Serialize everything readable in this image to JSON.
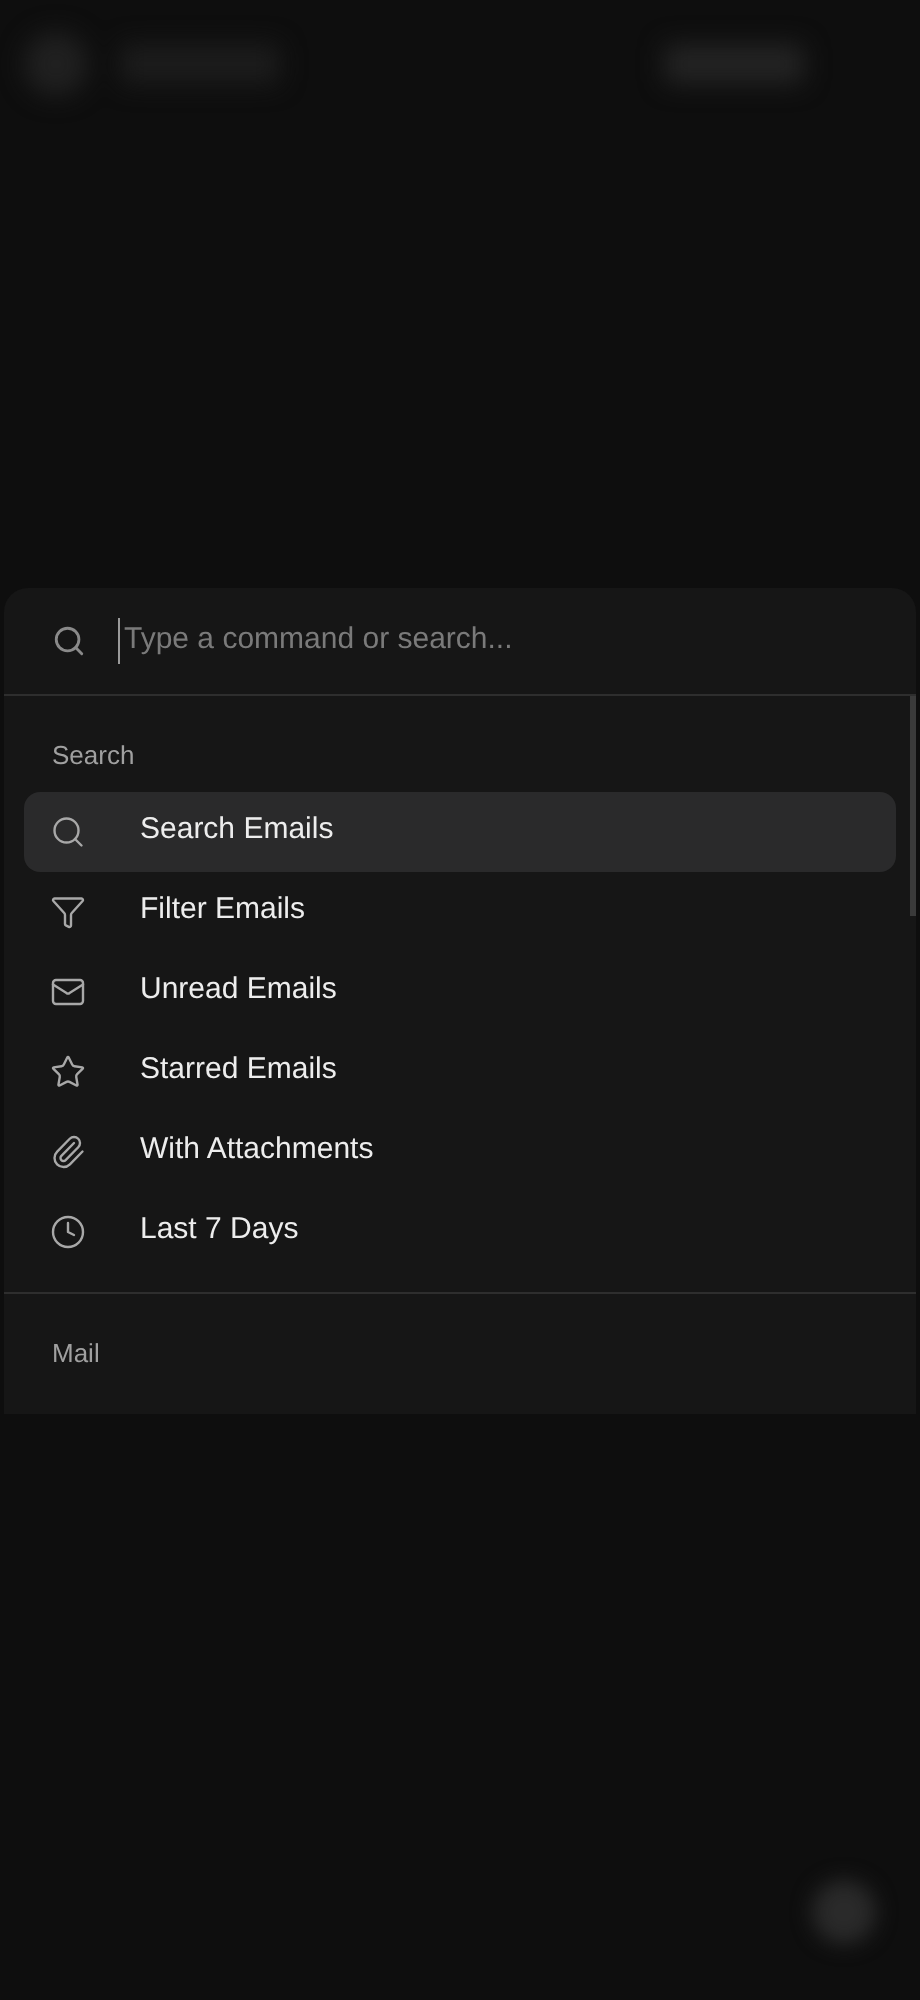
{
  "command_palette": {
    "search": {
      "placeholder": "Type a command or search..."
    },
    "groups": [
      {
        "heading": "Search",
        "items": [
          {
            "kind": "search",
            "label": "Search Emails",
            "selected": true
          },
          {
            "kind": "filter",
            "label": "Filter Emails",
            "selected": false
          },
          {
            "kind": "unread",
            "label": "Unread Emails",
            "selected": false
          },
          {
            "kind": "starred",
            "label": "Starred Emails",
            "selected": false
          },
          {
            "kind": "attachments",
            "label": "With Attachments",
            "selected": false
          },
          {
            "kind": "recent",
            "label": "Last 7 Days",
            "selected": false
          }
        ]
      },
      {
        "heading": "Mail"
      }
    ]
  }
}
